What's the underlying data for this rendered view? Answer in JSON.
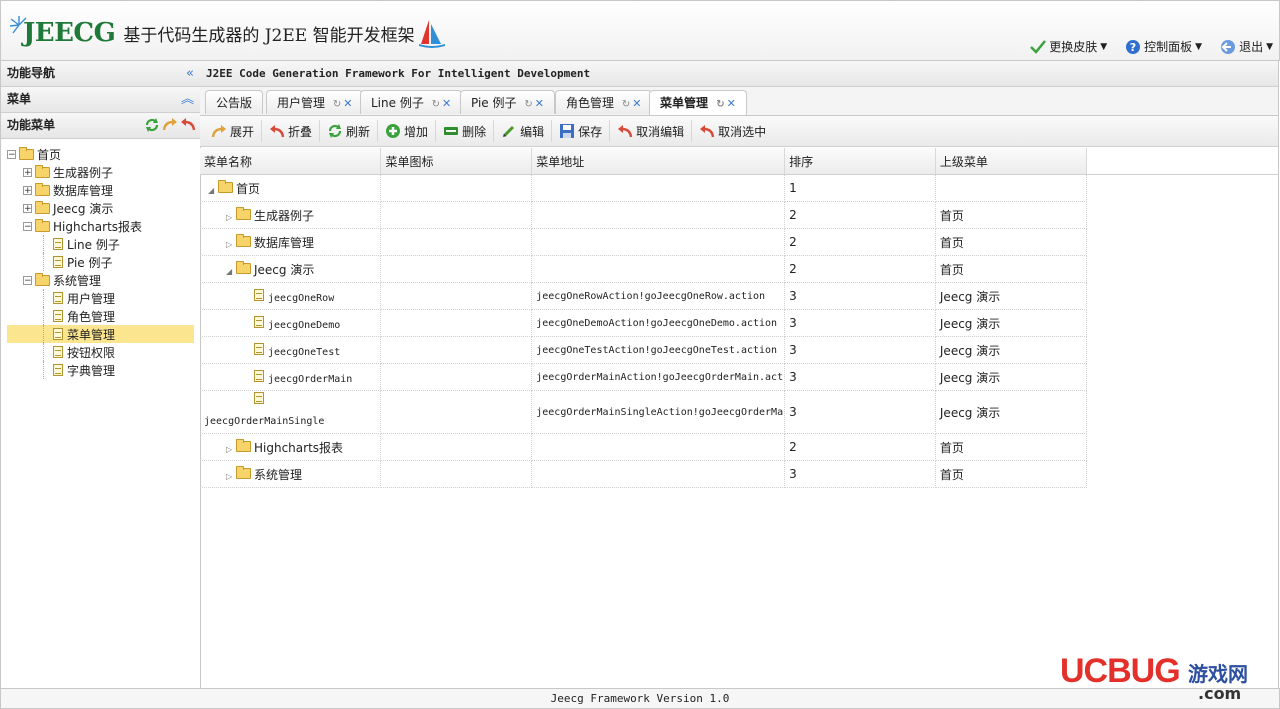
{
  "header": {
    "logo_text": "JEECG",
    "logo_subtitle": "基于代码生成器的 J2EE 智能开发框架",
    "links": [
      {
        "label": "更换皮肤",
        "icon": "check-icon"
      },
      {
        "label": "控制面板",
        "icon": "help-icon"
      },
      {
        "label": "退出",
        "icon": "logout-icon"
      }
    ]
  },
  "sidebar": {
    "nav_title": "功能导航",
    "menu_title": "菜单",
    "func_title": "功能菜单",
    "tree": [
      {
        "label": "首页"
      },
      {
        "label": "生成器例子"
      },
      {
        "label": "数据库管理"
      },
      {
        "label": "Jeecg 演示"
      },
      {
        "label": "Highcharts报表"
      },
      {
        "label": "Line 例子"
      },
      {
        "label": "Pie 例子"
      },
      {
        "label": "系统管理"
      },
      {
        "label": "用户管理"
      },
      {
        "label": "角色管理"
      },
      {
        "label": "菜单管理"
      },
      {
        "label": "按钮权限"
      },
      {
        "label": "字典管理"
      }
    ]
  },
  "main": {
    "title": "J2EE Code Generation Framework For Intelligent Development",
    "tabs": [
      {
        "label": "公告版"
      },
      {
        "label": "用户管理"
      },
      {
        "label": "Line 例子"
      },
      {
        "label": "Pie 例子"
      },
      {
        "label": "角色管理"
      },
      {
        "label": "菜单管理"
      }
    ],
    "toolbar": [
      {
        "label": "展开"
      },
      {
        "label": "折叠"
      },
      {
        "label": "刷新"
      },
      {
        "label": "增加"
      },
      {
        "label": "删除"
      },
      {
        "label": "编辑"
      },
      {
        "label": "保存"
      },
      {
        "label": "取消编辑"
      },
      {
        "label": "取消选中"
      }
    ],
    "columns": [
      "菜单名称",
      "菜单图标",
      "菜单地址",
      "排序",
      "上级菜单"
    ],
    "rows": [
      {
        "name": "首页",
        "icon": "",
        "url": "",
        "order": "1",
        "parent": ""
      },
      {
        "name": "生成器例子",
        "icon": "",
        "url": "",
        "order": "2",
        "parent": "首页"
      },
      {
        "name": "数据库管理",
        "icon": "",
        "url": "",
        "order": "2",
        "parent": "首页"
      },
      {
        "name": "Jeecg 演示",
        "icon": "",
        "url": "",
        "order": "2",
        "parent": "首页"
      },
      {
        "name": "jeecgOneRow",
        "icon": "",
        "url": "jeecgOneRowAction!goJeecgOneRow.action",
        "order": "3",
        "parent": "Jeecg 演示"
      },
      {
        "name": "jeecgOneDemo",
        "icon": "",
        "url": "jeecgOneDemoAction!goJeecgOneDemo.action",
        "order": "3",
        "parent": "Jeecg 演示"
      },
      {
        "name": "jeecgOneTest",
        "icon": "",
        "url": "jeecgOneTestAction!goJeecgOneTest.action",
        "order": "3",
        "parent": "Jeecg 演示"
      },
      {
        "name": "jeecgOrderMain",
        "icon": "",
        "url": "jeecgOrderMainAction!goJeecgOrderMain.act",
        "order": "3",
        "parent": "Jeecg 演示"
      },
      {
        "name": "jeecgOrderMainSingle",
        "icon": "",
        "url": "jeecgOrderMainSingleAction!goJeecgOrderMa",
        "order": "3",
        "parent": "Jeecg 演示"
      },
      {
        "name": "Highcharts报表",
        "icon": "",
        "url": "",
        "order": "2",
        "parent": "首页"
      },
      {
        "name": "系统管理",
        "icon": "",
        "url": "",
        "order": "3",
        "parent": "首页"
      }
    ]
  },
  "footer": {
    "text": "Jeecg Framework Version 1.0"
  },
  "watermark": {
    "brand": "UCBUG",
    "cn": "游戏网",
    "domain": ".com"
  }
}
